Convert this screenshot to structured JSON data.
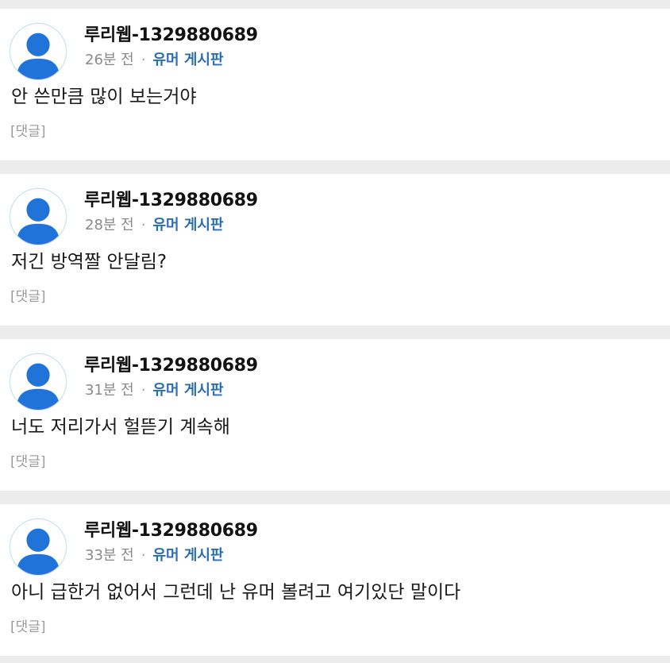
{
  "comments": [
    {
      "author": "루리웹-1329880689",
      "time": "26분 전",
      "separator": "·",
      "board": "유머 게시판",
      "text": "안 쓴만큼 많이 보는거야",
      "reply": "[댓글]"
    },
    {
      "author": "루리웹-1329880689",
      "time": "28분 전",
      "separator": "·",
      "board": "유머 게시판",
      "text": "저긴 방역짤 안달림?",
      "reply": "[댓글]"
    },
    {
      "author": "루리웹-1329880689",
      "time": "31분 전",
      "separator": "·",
      "board": "유머 게시판",
      "text": "너도 저리가서 헐뜯기 계속해",
      "reply": "[댓글]"
    },
    {
      "author": "루리웹-1329880689",
      "time": "33분 전",
      "separator": "·",
      "board": "유머 게시판",
      "text": "아니 급한거 없어서 그런데 난 유머 볼려고 여기있단 말이다",
      "reply": "[댓글]"
    }
  ],
  "icons": {
    "avatar": "default-user-avatar-icon"
  },
  "colors": {
    "avatar_fill": "#1f73d9",
    "board_link": "#2a6db5",
    "page_background": "#ececec"
  }
}
